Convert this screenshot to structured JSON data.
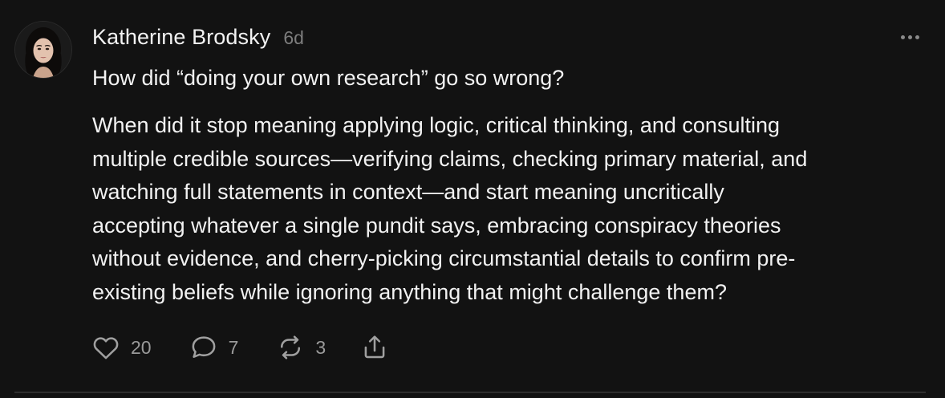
{
  "post": {
    "author": "Katherine Brodsky",
    "time_ago": "6d",
    "headline": "How did “doing your own research” go so wrong?",
    "body_lines": [
      "When did it stop meaning applying logic, critical thinking, and consulting",
      "multiple credible sources—verifying claims, checking primary material, and",
      "watching full statements in context—and start meaning uncritically",
      "accepting whatever a single pundit says, embracing conspiracy theories",
      "without evidence, and cherry-picking circumstantial details to confirm pre-",
      "existing beliefs while ignoring anything that might challenge them?"
    ],
    "likes": "20",
    "replies": "7",
    "reposts": "3",
    "icons": {
      "like": "heart-icon",
      "reply": "comment-bubble-icon",
      "repost": "repost-arrows-icon",
      "share": "share-upload-icon",
      "more": "more-horizontal-icon"
    }
  },
  "theme": {
    "background": "#121212",
    "text_primary": "#f2f2f2",
    "text_secondary": "#7d7d7d",
    "icon_color": "#9a9a9a",
    "divider": "#2e2e2e"
  }
}
